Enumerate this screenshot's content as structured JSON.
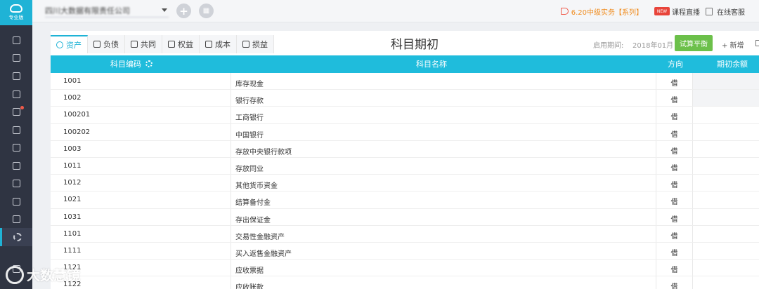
{
  "app": {
    "edition_label": "专业版"
  },
  "topbar": {
    "company_name": "四川大数据有限责任公司",
    "add_icon": "plus-icon",
    "grid_icon": "apps-icon",
    "promo_text": "6.20中级实务【系列】",
    "live_badge": "NEW",
    "live_label": "课程直播",
    "service_label": "在线客服"
  },
  "tabs": [
    {
      "label": "资产",
      "icon": "asset-icon"
    },
    {
      "label": "负债",
      "icon": "liability-icon"
    },
    {
      "label": "共同",
      "icon": "common-icon"
    },
    {
      "label": "权益",
      "icon": "equity-icon"
    },
    {
      "label": "成本",
      "icon": "cost-icon"
    },
    {
      "label": "损益",
      "icon": "profit-loss-icon"
    }
  ],
  "page": {
    "title": "科目期初",
    "period_label": "启用期间:",
    "period_value": "2018年01月",
    "trial_balance_label": "试算平衡",
    "add_label": "+ 新增"
  },
  "table": {
    "headers": {
      "code": "科目编码",
      "name": "科目名称",
      "direction": "方向",
      "balance": "期初余额"
    },
    "rows": [
      {
        "code": "1001",
        "name": "库存现金",
        "direction": "借"
      },
      {
        "code": "1002",
        "name": "银行存款",
        "direction": "借"
      },
      {
        "code": "100201",
        "name": "工商银行",
        "direction": "借"
      },
      {
        "code": "100202",
        "name": "中国银行",
        "direction": "借"
      },
      {
        "code": "1003",
        "name": "存放中央银行款项",
        "direction": "借"
      },
      {
        "code": "1011",
        "name": "存放同业",
        "direction": "借"
      },
      {
        "code": "1012",
        "name": "其他货币资金",
        "direction": "借"
      },
      {
        "code": "1021",
        "name": "结算备付金",
        "direction": "借"
      },
      {
        "code": "1031",
        "name": "存出保证金",
        "direction": "借"
      },
      {
        "code": "1101",
        "name": "交易性金融资产",
        "direction": "借"
      },
      {
        "code": "1111",
        "name": "买入返售金融资产",
        "direction": "借"
      },
      {
        "code": "1121",
        "name": "应收票据",
        "direction": "借"
      },
      {
        "code": "1122",
        "name": "应收账款",
        "direction": "借"
      }
    ]
  },
  "watermark": {
    "text": "大数慧镜"
  },
  "colors": {
    "accent": "#1fbcdc",
    "sidebar": "#2f3442",
    "success": "#6cc04a",
    "promo": "#f08c1e"
  }
}
